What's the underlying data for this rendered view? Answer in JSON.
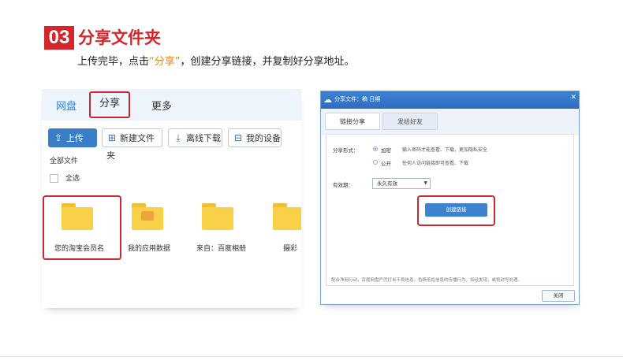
{
  "header": {
    "step_number": "03",
    "title": "分享文件夹",
    "desc_before": "上传完毕，点击",
    "desc_highlight": "“分享”",
    "desc_after": "，创建分享链接，并复制好分享地址。"
  },
  "netdisk": {
    "tabs": [
      "网盘",
      "分享",
      "更多"
    ],
    "toolbar": {
      "upload": "上传",
      "new_folder": "新建文件夹",
      "offline_download": "离线下载",
      "my_devices": "我的设备"
    },
    "all_files": "全部文件",
    "select_all": "全选",
    "folders": [
      "您的淘宝会员名",
      "我的应用数据",
      "来自：百度相册",
      "摄彩"
    ]
  },
  "share_dialog": {
    "title": "分享文件：稿 日期",
    "tabs": [
      "链接分享",
      "发给好友"
    ],
    "share_form_label": "分享形式：",
    "options": [
      {
        "label": "加密",
        "desc": "输入密码才能查看、下载，更加隐私安全",
        "selected": true
      },
      {
        "label": "公开",
        "desc": "任何人访问链接即可查看、下载",
        "selected": false
      }
    ],
    "validity_label": "有效期：",
    "validity_value": "永久有效",
    "create_button": "创建链接",
    "notice": "配合净网行动，百度网盘严厉打击不良信息、色情低俗信息的传播行为，如经发现，或将封号处理。",
    "close_button": "关闭"
  },
  "colors": {
    "accent_red": "#d7262b",
    "highlight_orange": "#e8891c",
    "link_blue": "#2f7fd9",
    "folder_yellow": "#f8d148"
  }
}
